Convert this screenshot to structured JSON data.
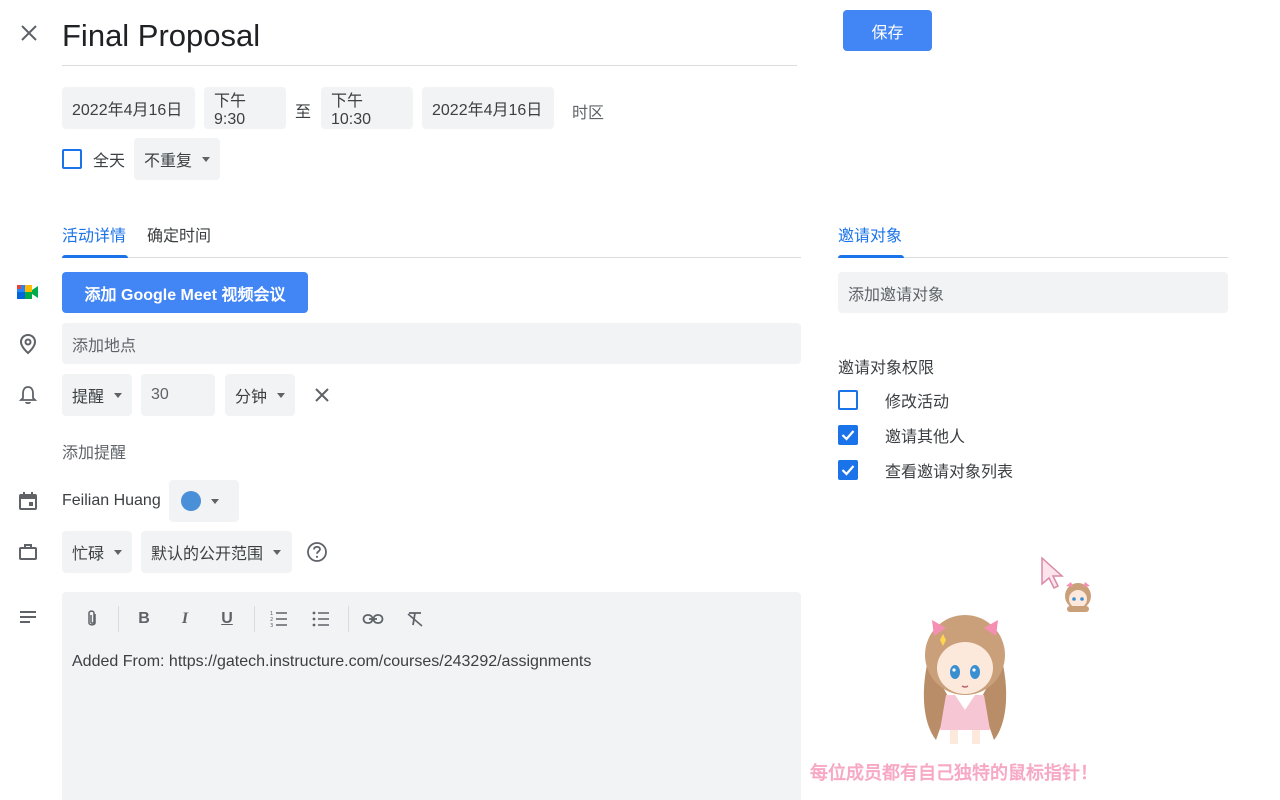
{
  "header": {
    "title": "Final Proposal",
    "save_label": "保存"
  },
  "datetime": {
    "start_date": "2022年4月16日",
    "start_time": "下午9:30",
    "to_label": "至",
    "end_time": "下午10:30",
    "end_date": "2022年4月16日",
    "timezone_label": "时区",
    "allday_label": "全天",
    "repeat_label": "不重复"
  },
  "tabs": [
    {
      "label": "活动详情",
      "active": true
    },
    {
      "label": "确定时间",
      "active": false
    }
  ],
  "meet": {
    "button_label": "添加 Google Meet 视频会议"
  },
  "location": {
    "placeholder": "添加地点"
  },
  "notification": {
    "type": "提醒",
    "value": "30",
    "unit": "分钟",
    "add_label": "添加提醒"
  },
  "calendar": {
    "owner": "Feilian Huang",
    "color": "#4a90d9"
  },
  "availability": {
    "status": "忙碌",
    "visibility": "默认的公开范围"
  },
  "description": {
    "text": "Added From: https://gatech.instructure.com/courses/243292/assignments",
    "toolbar_icons": [
      "attachment-icon",
      "bold-icon",
      "italic-icon",
      "underline-icon",
      "numbered-list-icon",
      "bulleted-list-icon",
      "link-icon",
      "remove-formatting-icon"
    ]
  },
  "guests": {
    "tab_label": "邀请对象",
    "add_placeholder": "添加邀请对象",
    "permissions_title": "邀请对象权限",
    "permissions": [
      {
        "label": "修改活动",
        "checked": false
      },
      {
        "label": "邀请其他人",
        "checked": true
      },
      {
        "label": "查看邀请对象列表",
        "checked": true
      }
    ]
  },
  "overlay": {
    "caption": "每位成员都有自己独特的鼠标指针！"
  },
  "colors": {
    "accent": "#1a73e8",
    "button": "#4285f4",
    "field_bg": "#f1f3f4",
    "caption": "#f7a8c4"
  }
}
